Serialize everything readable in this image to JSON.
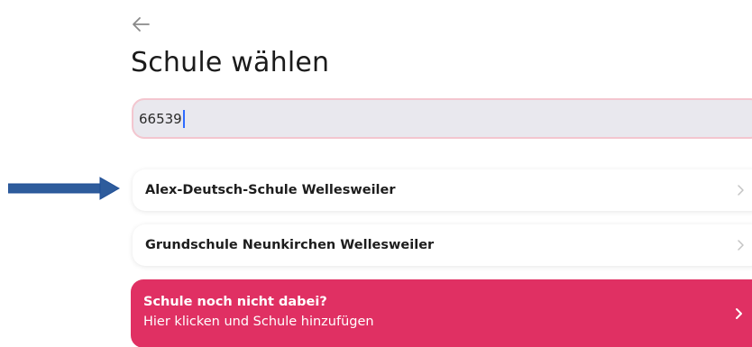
{
  "header": {
    "back_icon": "arrow-left-icon",
    "title": "Schule wählen"
  },
  "search": {
    "value": "66539",
    "border_color": "#f3c6cf",
    "background": "#e9e8ee"
  },
  "results": [
    {
      "name": "Alex-Deutsch-Schule Wellesweiler",
      "icon": "chevron-right-icon"
    },
    {
      "name": "Grundschule Neunkirchen Wellesweiler",
      "icon": "chevron-right-icon"
    }
  ],
  "add_school": {
    "title": "Schule noch nicht dabei?",
    "subtitle": "Hier klicken und Schule hinzufügen",
    "background": "#e03063",
    "icon": "chevron-right-icon"
  },
  "annotation": {
    "icon": "blue-arrow-icon",
    "color": "#1f4e96"
  }
}
